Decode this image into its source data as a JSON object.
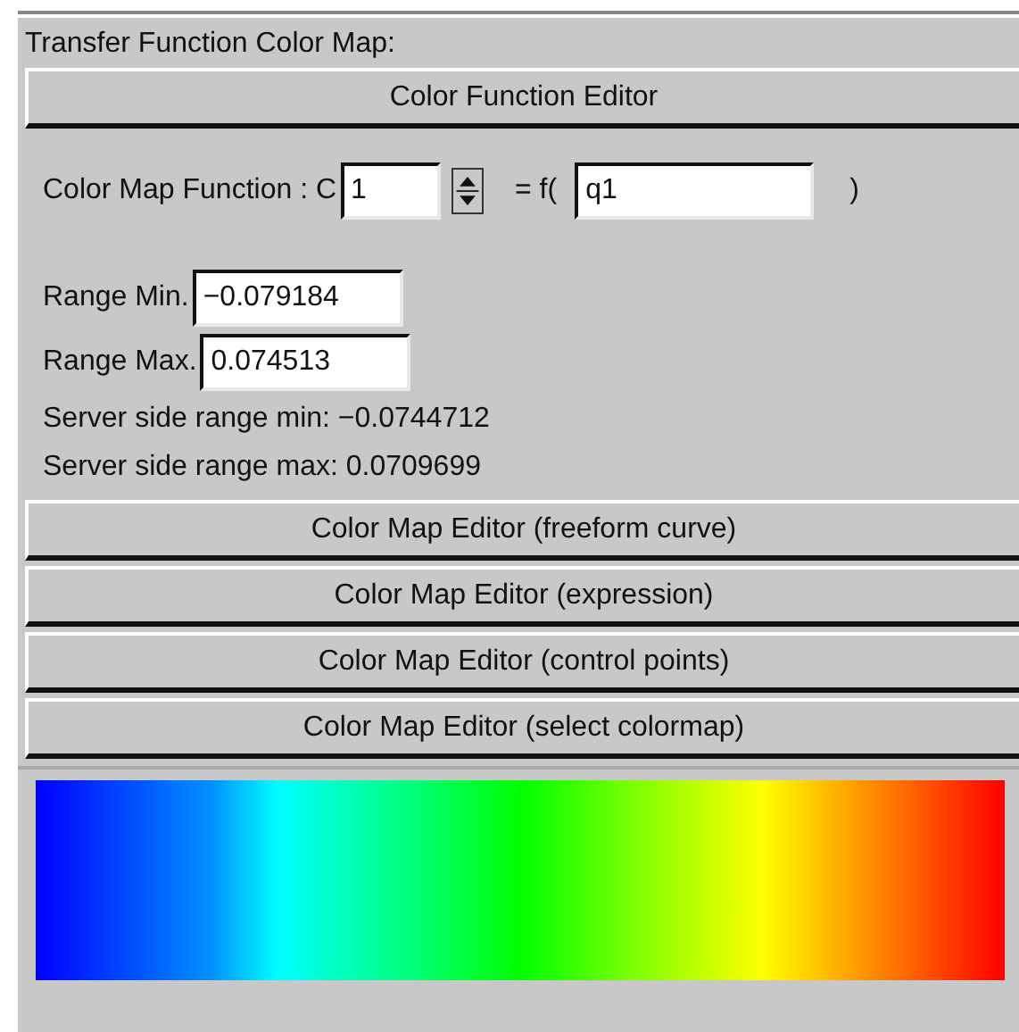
{
  "panel_title": "Transfer Function Color Map:",
  "editor_button": "Color Function Editor",
  "function_row": {
    "label": "Color Map Function : C",
    "component": "1",
    "equals": "= f(",
    "variable": "q1",
    "close": ")"
  },
  "range_min": {
    "label": "Range Min.",
    "value": "−0.079184"
  },
  "range_max": {
    "label": "Range Max.",
    "value": "0.074513"
  },
  "server_lines": [
    "Server side range min: −0.0744712",
    "Server side range max: 0.0709699"
  ],
  "map_buttons": [
    "Color Map Editor (freeform curve)",
    "Color Map Editor (expression)",
    "Color Map Editor (control points)",
    "Color Map Editor (select colormap)"
  ]
}
